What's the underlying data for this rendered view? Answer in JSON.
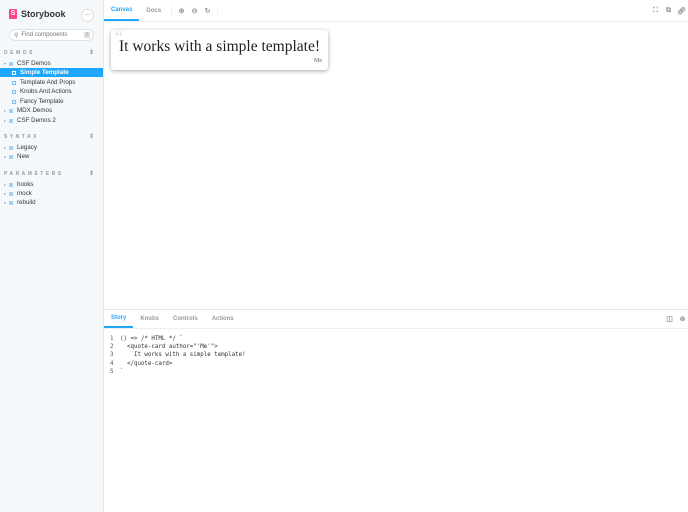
{
  "sidebar": {
    "brand": "Storybook",
    "logo_letter": "S",
    "menu": "···",
    "search_placeholder": "Find components",
    "search_shortcut": "/",
    "sections": [
      {
        "title": "DEMOS",
        "items": [
          {
            "label": "CSF Demos",
            "children": [
              "Simple Template",
              "Template And Props",
              "Knobs And Actions",
              "Fancy Template"
            ]
          },
          {
            "label": "MDX Demos"
          },
          {
            "label": "CSF Demos 2"
          }
        ]
      },
      {
        "title": "SYNTAX",
        "items": [
          {
            "label": "Legacy"
          },
          {
            "label": "New"
          }
        ]
      },
      {
        "title": "PARAMETERS",
        "items": [
          {
            "label": "hooks"
          },
          {
            "label": "mock"
          },
          {
            "label": "rebuild"
          }
        ]
      }
    ],
    "selected": "Simple Template"
  },
  "toolbar": {
    "tabs": [
      "Canvas",
      "Docs"
    ],
    "active": "Canvas"
  },
  "preview": {
    "quote": "It works with a simple template!",
    "author": "Me"
  },
  "addons": {
    "tabs": [
      "Story",
      "Knobs",
      "Controls",
      "Actions"
    ],
    "active": "Story",
    "code": [
      "() => /* HTML */ `",
      "  <quote-card author=\"'Me'\">",
      "    It works with a simple template!",
      "  </quote-card>",
      "`"
    ]
  },
  "colors": {
    "accent": "#1ea7fd",
    "brand": "#ff4785"
  }
}
